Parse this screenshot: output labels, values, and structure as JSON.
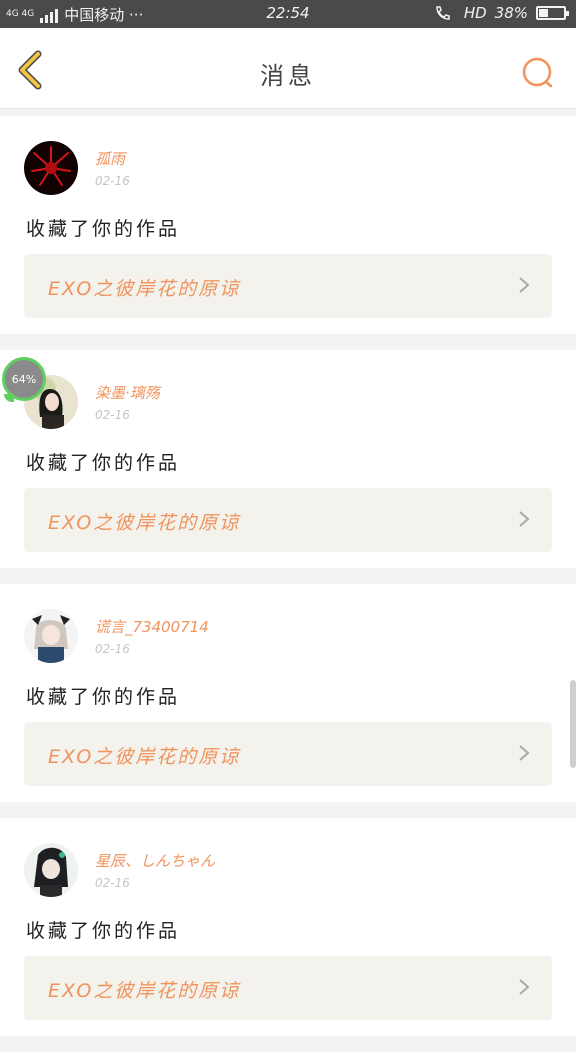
{
  "status_bar": {
    "network_top": "4G 4G",
    "carrier": "中国移动 ···",
    "time": "22:54",
    "hd": "HD",
    "battery_percent": "38%"
  },
  "header": {
    "title": "消息",
    "back_icon": "chevron-left-icon",
    "search_icon": "search-icon"
  },
  "progress_bubble": "64%",
  "messages": [
    {
      "username": "孤雨",
      "date": "02-16",
      "action": "收藏了你的作品",
      "work": "EXO之彼岸花的原谅"
    },
    {
      "username": "染墨·璃殇",
      "date": "02-16",
      "action": "收藏了你的作品",
      "work": "EXO之彼岸花的原谅"
    },
    {
      "username": "谎言_73400714",
      "date": "02-16",
      "action": "收藏了你的作品",
      "work": "EXO之彼岸花的原谅"
    },
    {
      "username": "星辰、しんちゃん",
      "date": "02-16",
      "action": "收藏了你的作品",
      "work": "EXO之彼岸花的原谅"
    }
  ],
  "colors": {
    "accent": "#f0935c",
    "back_icon": "#f5c542",
    "status_bar_bg": "#4a4a4a"
  }
}
